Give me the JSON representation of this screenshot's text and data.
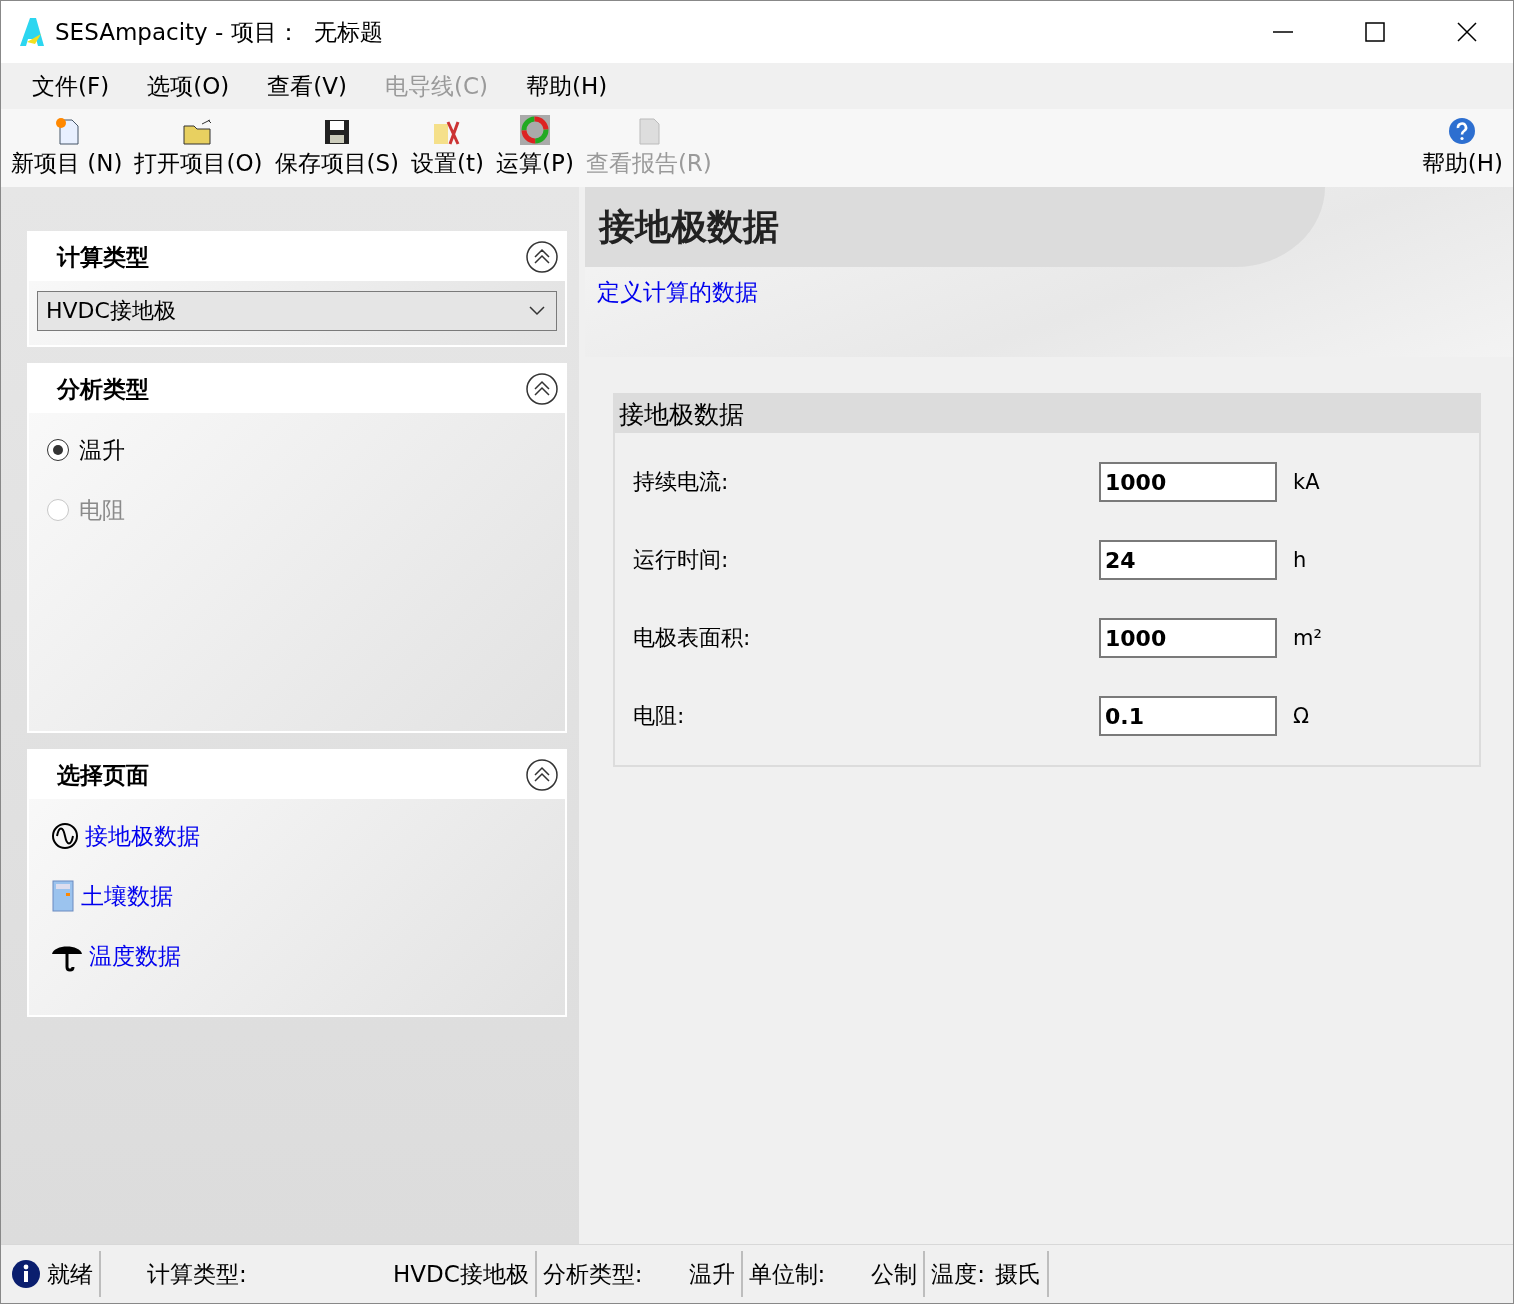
{
  "window": {
    "title": "SESAmpacity - 项目：  无标题"
  },
  "menu": [
    {
      "label": "文件(F)",
      "disabled": false
    },
    {
      "label": "选项(O)",
      "disabled": false
    },
    {
      "label": "查看(V)",
      "disabled": false
    },
    {
      "label": "电导线(C)",
      "disabled": true
    },
    {
      "label": "帮助(H)",
      "disabled": false
    }
  ],
  "toolbar": [
    {
      "label": "新项目 (N)",
      "kind": "new",
      "disabled": false
    },
    {
      "label": "打开项目(O)",
      "kind": "open",
      "disabled": false
    },
    {
      "label": "保存项目(S)",
      "kind": "save",
      "disabled": false
    },
    {
      "label": "设置(t)",
      "kind": "settings",
      "disabled": false
    },
    {
      "label": "运算(P)",
      "kind": "run",
      "disabled": false
    },
    {
      "label": "查看报告(R)",
      "kind": "report",
      "disabled": true
    }
  ],
  "toolbar_help": {
    "label": "帮助(H)"
  },
  "calc_panel": {
    "title": "计算类型",
    "value": "HVDC接地极"
  },
  "analysis_panel": {
    "title": "分析类型",
    "options": [
      {
        "label": "温升",
        "selected": true,
        "disabled": false
      },
      {
        "label": "电阻",
        "selected": false,
        "disabled": true
      }
    ]
  },
  "pages_panel": {
    "title": "选择页面",
    "items": [
      {
        "label": "接地极数据",
        "kind": "wave"
      },
      {
        "label": "土壤数据",
        "kind": "calculator"
      },
      {
        "label": "温度数据",
        "kind": "umbrella"
      }
    ]
  },
  "header": {
    "title": "接地极数据",
    "subtitle": "定义计算的数据"
  },
  "group": {
    "title": "接地极数据",
    "fields": [
      {
        "label": "持续电流:",
        "value": "1000",
        "unit": "kA"
      },
      {
        "label": "运行时间:",
        "value": "24",
        "unit": "h"
      },
      {
        "label": "电极表面积:",
        "value": "1000",
        "unit": "m²"
      },
      {
        "label": "电阻:",
        "value": "0.1",
        "unit": "Ω"
      }
    ]
  },
  "status_bar": [
    {
      "label": "就绪",
      "kind": "info"
    },
    {
      "label": "计算类型:",
      "value": "HVDC接地极"
    },
    {
      "label": "分析类型:",
      "value": "温升"
    },
    {
      "label": "单位制:",
      "value": "公制"
    },
    {
      "label": "温度:",
      "value": "摄氏"
    }
  ]
}
